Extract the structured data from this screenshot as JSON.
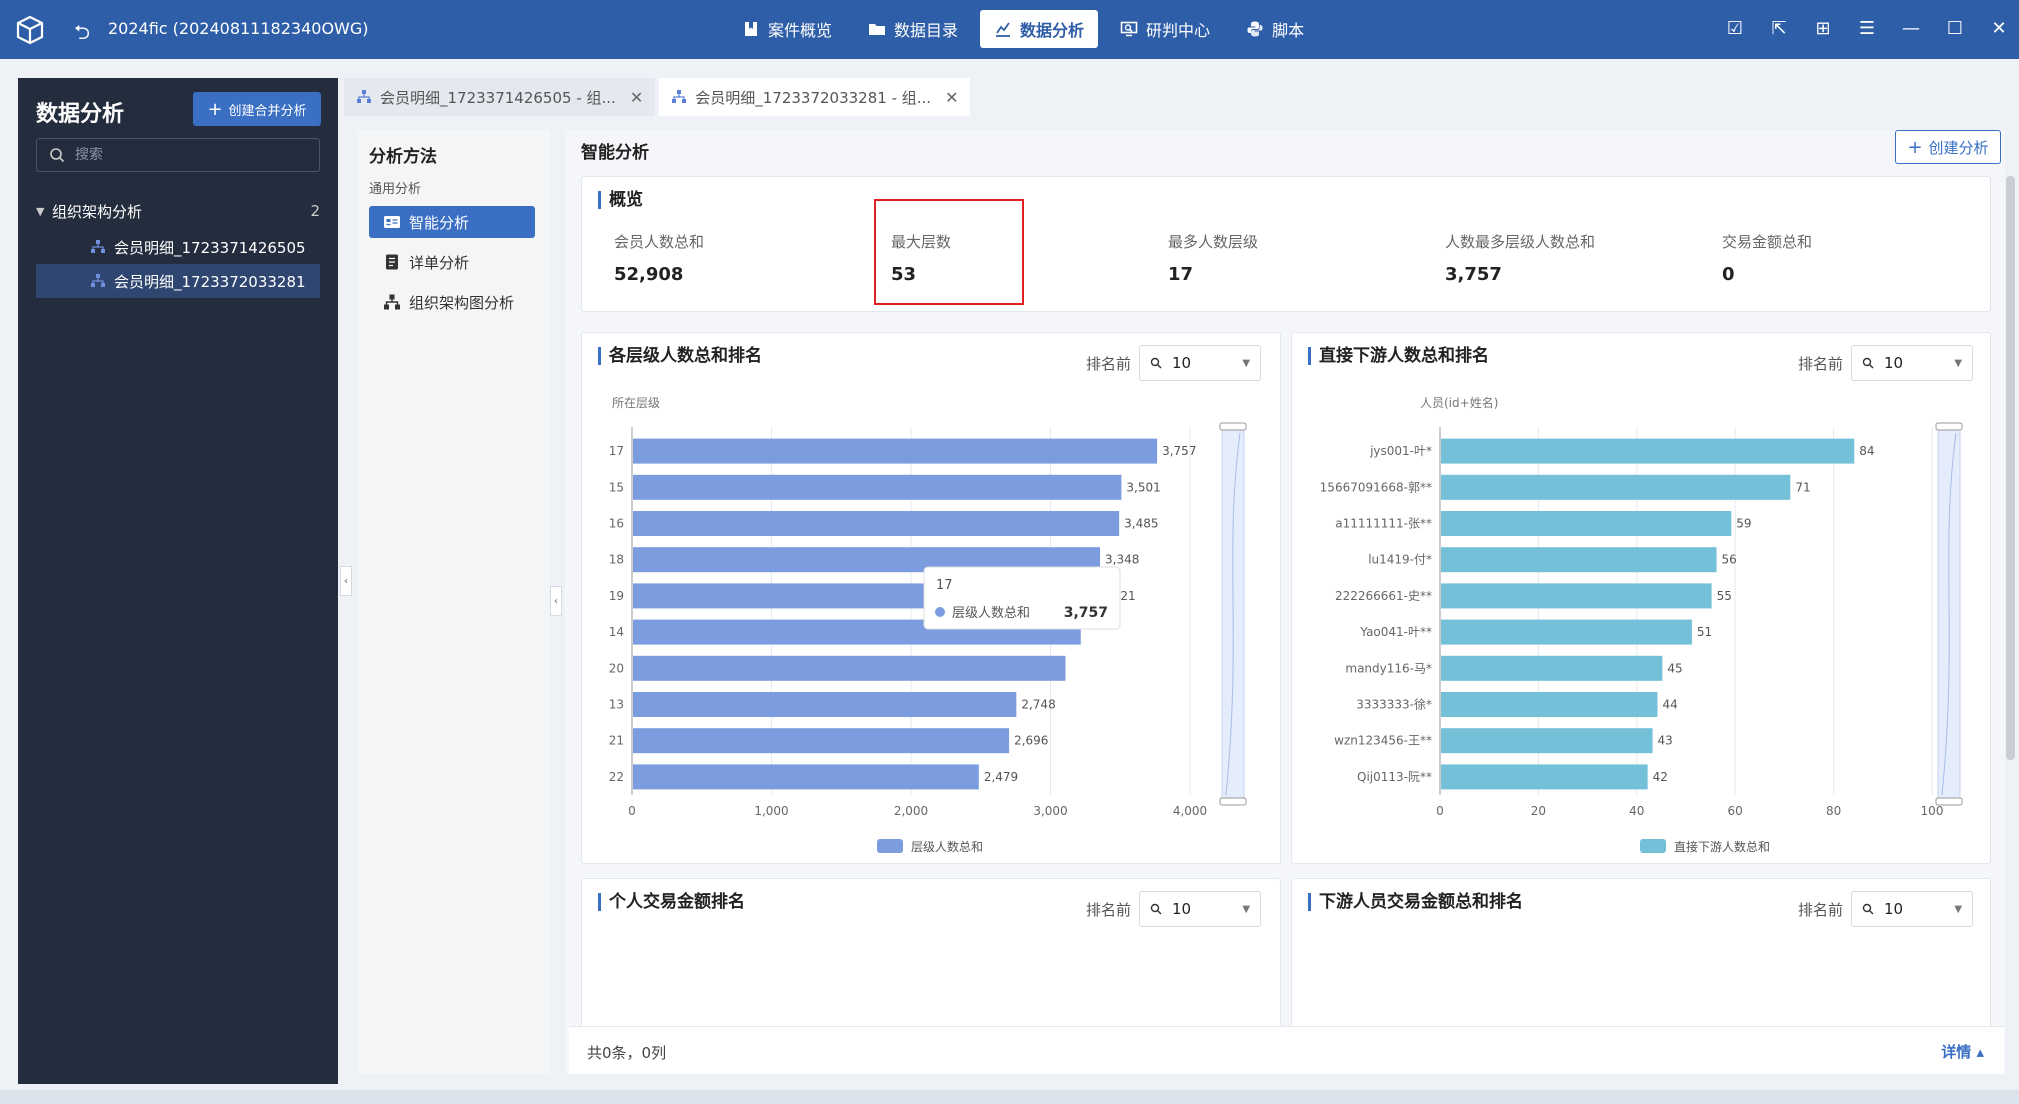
{
  "titlebar": {
    "app_title": "2024fic (20240811182340OWG)",
    "nav": [
      {
        "label": "案件概览",
        "icon": "bookmark-icon",
        "active": false
      },
      {
        "label": "数据目录",
        "icon": "folder-icon",
        "active": false
      },
      {
        "label": "数据分析",
        "icon": "chart-icon",
        "active": true
      },
      {
        "label": "研判中心",
        "icon": "monitor-search-icon",
        "active": false
      },
      {
        "label": "脚本",
        "icon": "python-icon",
        "active": false
      }
    ]
  },
  "left_panel": {
    "title": "数据分析",
    "create_label": "创建合并分析",
    "search_placeholder": "搜索",
    "tree": {
      "group_label": "组织架构分析",
      "group_count": "2",
      "items": [
        {
          "label": "会员明细_1723371426505",
          "selected": false
        },
        {
          "label": "会员明细_1723372033281",
          "selected": true
        }
      ]
    }
  },
  "tabs": [
    {
      "label": "会员明细_1723371426505 - 组...",
      "active": false
    },
    {
      "label": "会员明细_1723372033281 - 组...",
      "active": true
    }
  ],
  "method_panel": {
    "title": "分析方法",
    "subtitle": "通用分析",
    "items": [
      {
        "label": "智能分析",
        "icon": "smart-analysis-icon",
        "active": true
      },
      {
        "label": "详单分析",
        "icon": "document-icon",
        "active": false
      },
      {
        "label": "组织架构图分析",
        "icon": "org-chart-icon",
        "active": false
      }
    ]
  },
  "main": {
    "title": "智能分析",
    "create_label": "创建分析",
    "overview": {
      "title": "概览",
      "stats": [
        {
          "label": "会员人数总和",
          "value": "52,908"
        },
        {
          "label": "最大层数",
          "value": "53"
        },
        {
          "label": "最多人数层级",
          "value": "17"
        },
        {
          "label": "人数最多层级人数总和",
          "value": "3,757"
        },
        {
          "label": "交易金额总和",
          "value": "0"
        }
      ]
    },
    "rank_label": "排名前",
    "rank_value": "10",
    "card_titles": {
      "level": "各层级人数总和排名",
      "downstream": "直接下游人数总和排名",
      "personal_tx": "个人交易金额排名",
      "downstream_tx": "下游人员交易金额总和排名"
    },
    "footer": {
      "summary": "共0条，0列",
      "detail": "详情 ▴"
    }
  },
  "chart_data": [
    {
      "type": "bar",
      "orientation": "horizontal",
      "title": "各层级人数总和排名",
      "ylabel": "所在层级",
      "categories": [
        "17",
        "15",
        "16",
        "18",
        "19",
        "14",
        "20",
        "13",
        "21",
        "22"
      ],
      "series": [
        {
          "name": "层级人数总和",
          "values": [
            3757,
            3501,
            3485,
            3348,
            3321,
            3210,
            3100,
            2748,
            2696,
            2479
          ],
          "value_labels": [
            "3,757",
            "3,501",
            "3,485",
            "3,348",
            "3,321",
            "",
            "",
            "2,748",
            "2,696",
            "2,479"
          ]
        }
      ],
      "xlim": [
        0,
        4000
      ],
      "xticks": [
        "0",
        "1,000",
        "2,000",
        "3,000",
        "4,000"
      ],
      "color": "#7b9de0",
      "legend": "bottom",
      "tooltip": {
        "category": "17",
        "series": "层级人数总和",
        "value": "3,757"
      }
    },
    {
      "type": "bar",
      "orientation": "horizontal",
      "title": "直接下游人数总和排名",
      "ylabel": "人员(id+姓名)",
      "categories": [
        "jys001-叶*",
        "15667091668-郭**",
        "a11111111-张**",
        "lu1419-付*",
        "222266661-史**",
        "Yao041-叶**",
        "mandy116-马*",
        "3333333-徐*",
        "wzn123456-王**",
        "Qij0113-阮**"
      ],
      "series": [
        {
          "name": "直接下游人数总和",
          "values": [
            84,
            71,
            59,
            56,
            55,
            51,
            45,
            44,
            43,
            42
          ],
          "value_labels": [
            "84",
            "71",
            "59",
            "56",
            "55",
            "51",
            "45",
            "44",
            "43",
            "42"
          ]
        }
      ],
      "xlim": [
        0,
        100
      ],
      "xticks": [
        "0",
        "20",
        "40",
        "60",
        "80",
        "100"
      ],
      "color": "#73c0d8",
      "legend": "bottom"
    }
  ]
}
